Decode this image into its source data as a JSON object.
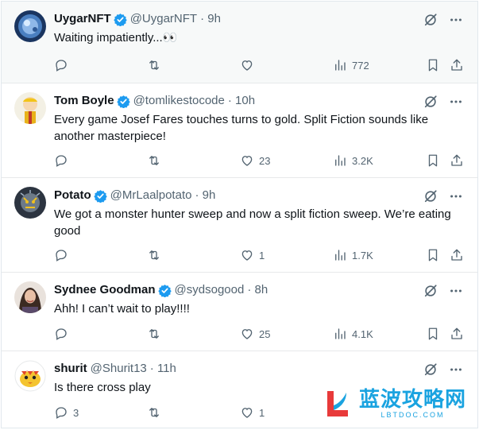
{
  "tweets": [
    {
      "name": "UygarNFT",
      "handle": "@UygarNFT",
      "time": "· 9h",
      "text": "Waiting impatiently...👀",
      "replies": "",
      "retweets": "",
      "likes": "",
      "views": "772",
      "avatar": "blue-sphere-avatar"
    },
    {
      "name": "Tom Boyle",
      "handle": "@tomlikestocode",
      "time": "· 10h",
      "text": "Every game Josef Fares touches turns to gold. Split Fiction sounds like another masterpiece!",
      "replies": "",
      "retweets": "",
      "likes": "23",
      "views": "3.2K",
      "avatar": "anime-hero-avatar"
    },
    {
      "name": "Potato",
      "handle": "@MrLaalpotato",
      "time": "· 9h",
      "text": "We got a monster hunter sweep and now a split fiction sweep. We’re eating good",
      "replies": "",
      "retweets": "",
      "likes": "1",
      "views": "1.7K",
      "avatar": "masked-face-avatar"
    },
    {
      "name": "Sydnee Goodman",
      "handle": "@sydsogood",
      "time": "· 8h",
      "text": "Ahh! I can’t wait to play!!!!",
      "replies": "",
      "retweets": "",
      "likes": "25",
      "views": "4.1K",
      "avatar": "person-photo-avatar"
    },
    {
      "name": "shurit",
      "handle": "@Shurit13",
      "time": "· 11h",
      "text": "Is there cross play",
      "replies": "3",
      "retweets": "",
      "likes": "1",
      "views": "",
      "avatar": "cartoon-bird-avatar"
    }
  ],
  "watermark": {
    "text": "蓝波攻略网",
    "subtext": "LBTDOC.COM"
  },
  "colors": {
    "verified": "#1d9bf0",
    "muted": "#536471",
    "text": "#0f1419",
    "divider": "#e7e9ea",
    "watermark": "#1aa3e0",
    "watermark_logo": "#e83a3a"
  }
}
